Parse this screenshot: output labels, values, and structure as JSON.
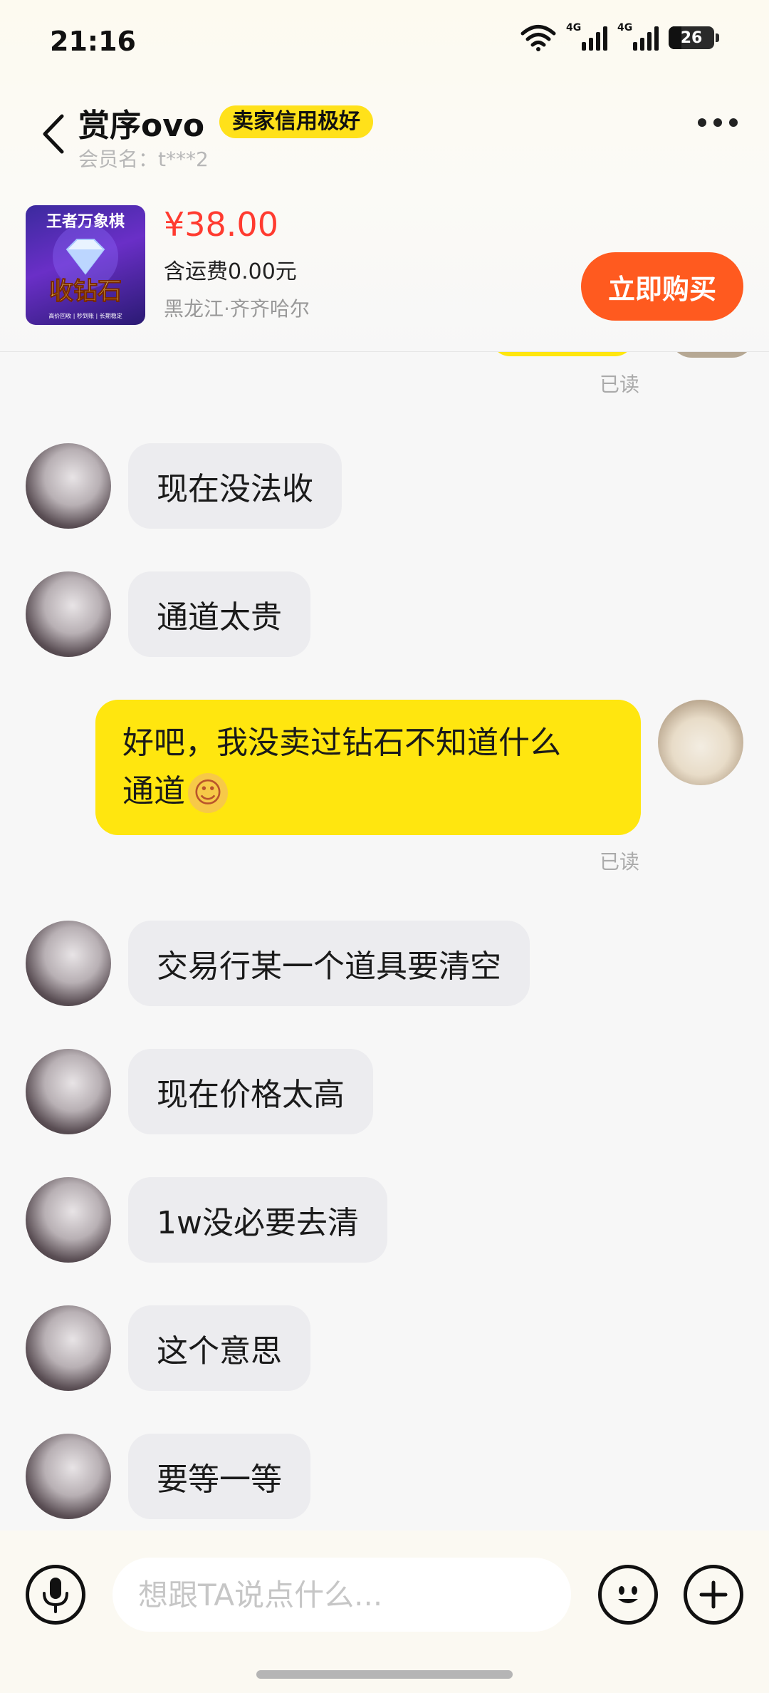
{
  "status_bar": {
    "time": "21:16",
    "network_1": "4G",
    "network_2": "4G",
    "battery": "26"
  },
  "header": {
    "seller_name": "赏序ovo",
    "credit_badge": "卖家信用极好",
    "member_label": "会员名：t***2"
  },
  "product": {
    "image_title": "王者万象棋",
    "image_main": "收钻石",
    "image_footer": "高价回收 | 秒到账 | 长期稳定",
    "price": "¥38.00",
    "shipping": "含运费0.00元",
    "location": "黑龙江·齐齐哈尔",
    "buy_label": "立即购买"
  },
  "messages": [
    {
      "side": "in",
      "text": "现在没法收"
    },
    {
      "side": "in",
      "text": "通道太贵"
    },
    {
      "side": "out",
      "line1": "好吧，我没卖过钻石不知道什么",
      "line2": "通道",
      "emoji": "☺",
      "read": "已读"
    },
    {
      "side": "in",
      "text": "交易行某一个道具要清空"
    },
    {
      "side": "in",
      "text": "现在价格太高"
    },
    {
      "side": "in",
      "text": "1w没必要去清"
    },
    {
      "side": "in",
      "text": "这个意思"
    },
    {
      "side": "in",
      "text": "要等一等"
    }
  ],
  "top_read": "已读",
  "composer": {
    "placeholder": "想跟TA说点什么..."
  },
  "colors": {
    "accent_yellow": "#ffe60f",
    "buy_orange": "#ff5a1f",
    "price_red": "#ff3b30"
  }
}
